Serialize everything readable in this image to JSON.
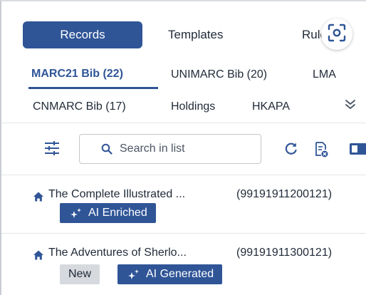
{
  "top_tabs": [
    {
      "label": "Records",
      "active": true
    },
    {
      "label": "Templates",
      "active": false
    },
    {
      "label": "Rules",
      "active": false
    }
  ],
  "format_tabs_row1": [
    {
      "label": "MARC21 Bib (22)",
      "active": true
    },
    {
      "label": "UNIMARC Bib (20)",
      "active": false
    },
    {
      "label": "LMA",
      "active": false
    }
  ],
  "format_tabs_row2": [
    {
      "label": "CNMARC Bib (17)",
      "active": false
    },
    {
      "label": "Holdings",
      "active": false
    },
    {
      "label": "HKAPA",
      "active": false
    }
  ],
  "search": {
    "placeholder": "Search in list",
    "value": ""
  },
  "records": [
    {
      "title": "The Complete Illustrated ...",
      "id": "(99191911200121)",
      "badges": [
        "AI Enriched"
      ]
    },
    {
      "title": "The Adventures of Sherlo...",
      "id": "(99191911300121)",
      "badges": [
        "New",
        "AI Generated"
      ]
    }
  ],
  "icons": {
    "scan": "scan-icon",
    "more": "chevron-double-down-icon",
    "filter": "sliders-icon",
    "search": "search-icon",
    "refresh": "refresh-icon",
    "records_action": "document-x-icon",
    "panel": "panel-icon",
    "home": "home-icon",
    "sparkle": "sparkle-icon"
  },
  "colors": {
    "accent": "#2f5597",
    "new_badge": "#d6d9dd",
    "text": "#1f2937"
  }
}
